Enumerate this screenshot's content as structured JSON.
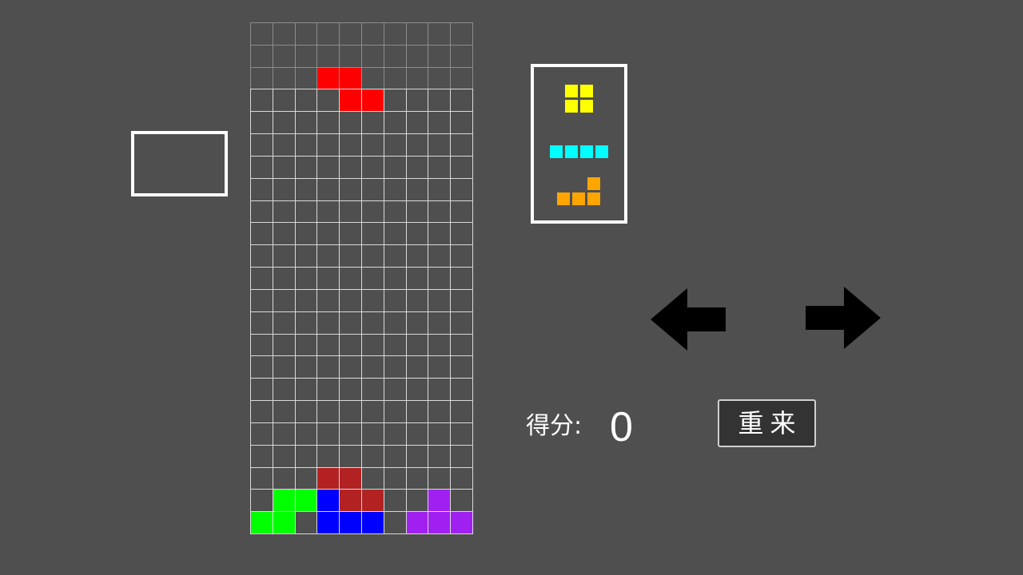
{
  "board": {
    "cols": 10,
    "rows": 23,
    "hidden_rows": 3,
    "grid_line_color": "#d9d9d9",
    "hidden_grid_line_color": "#8c8c8c",
    "falling_piece": {
      "type": "Z",
      "color": "#ff0000",
      "cells": [
        [
          3,
          2
        ],
        [
          4,
          2
        ],
        [
          4,
          3
        ],
        [
          5,
          3
        ]
      ]
    },
    "locked_cells": [
      {
        "col": 3,
        "row": 20,
        "color": "#b22222"
      },
      {
        "col": 4,
        "row": 20,
        "color": "#b22222"
      },
      {
        "col": 1,
        "row": 21,
        "color": "#00ff00"
      },
      {
        "col": 2,
        "row": 21,
        "color": "#00ff00"
      },
      {
        "col": 3,
        "row": 21,
        "color": "#0000ff"
      },
      {
        "col": 4,
        "row": 21,
        "color": "#b22222"
      },
      {
        "col": 5,
        "row": 21,
        "color": "#b22222"
      },
      {
        "col": 8,
        "row": 21,
        "color": "#a020f0"
      },
      {
        "col": 0,
        "row": 22,
        "color": "#00ff00"
      },
      {
        "col": 1,
        "row": 22,
        "color": "#00ff00"
      },
      {
        "col": 3,
        "row": 22,
        "color": "#0000ff"
      },
      {
        "col": 4,
        "row": 22,
        "color": "#0000ff"
      },
      {
        "col": 5,
        "row": 22,
        "color": "#0000ff"
      },
      {
        "col": 7,
        "row": 22,
        "color": "#a020f0"
      },
      {
        "col": 8,
        "row": 22,
        "color": "#a020f0"
      },
      {
        "col": 9,
        "row": 22,
        "color": "#a020f0"
      }
    ]
  },
  "hold": {
    "piece": null
  },
  "next_queue": [
    {
      "type": "O",
      "color": "#ffff00",
      "cells": [
        [
          0,
          0
        ],
        [
          1,
          0
        ],
        [
          0,
          1
        ],
        [
          1,
          1
        ]
      ]
    },
    {
      "type": "I",
      "color": "#00ffff",
      "cells": [
        [
          0,
          0
        ],
        [
          1,
          0
        ],
        [
          2,
          0
        ],
        [
          3,
          0
        ]
      ]
    },
    {
      "type": "L",
      "color": "#ffa500",
      "cells": [
        [
          2,
          0
        ],
        [
          0,
          1
        ],
        [
          1,
          1
        ],
        [
          2,
          1
        ]
      ]
    }
  ],
  "controls": {
    "left_arrow_icon": "arrow-left-icon",
    "right_arrow_icon": "arrow-right-icon",
    "arrow_color": "#000000"
  },
  "score": {
    "label": "得分:",
    "value": "0"
  },
  "restart": {
    "label": "重来"
  }
}
